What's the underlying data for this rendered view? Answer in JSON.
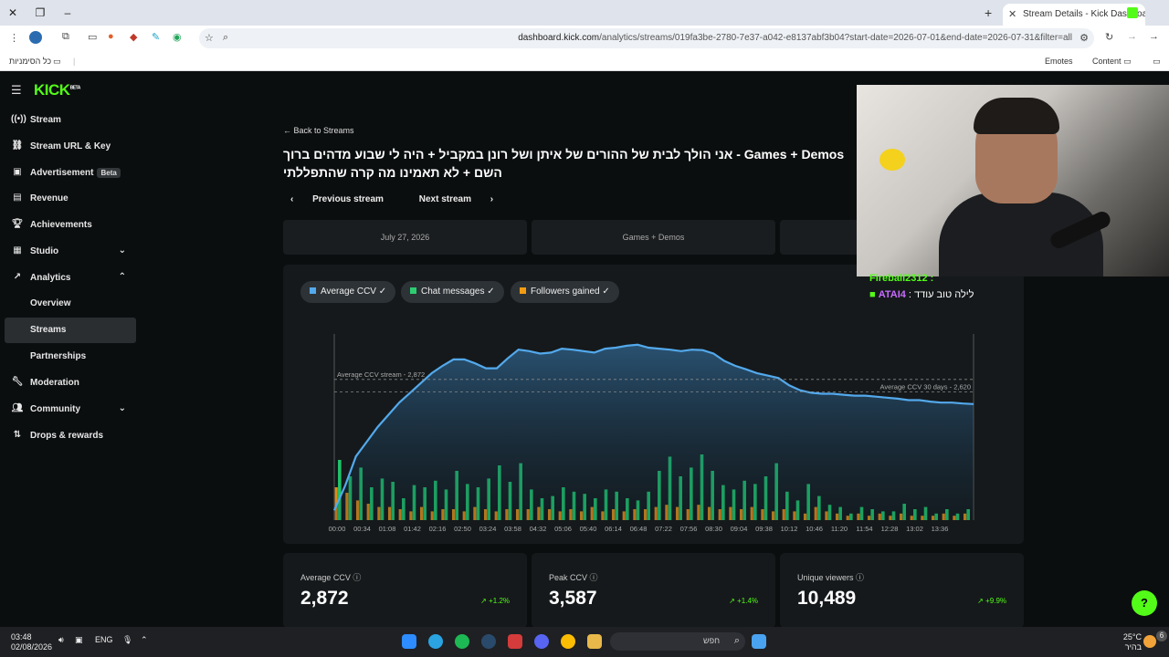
{
  "browser": {
    "tab_title": "Stream Details - Kick Dashboard",
    "url_host": "dashboard.kick.com",
    "url_path": "/analytics/streams/019fa3be-2780-7e37-a042-e8137abf3b04?start-date=2026-07-01&end-date=2026-07-31&filter=all",
    "bookmarks_all": "כל הסימניות",
    "bookmark_emotes": "Emotes",
    "bookmark_content": "Content"
  },
  "sidebar": {
    "logo": "KICK",
    "logo_badge": "BETA",
    "items": [
      {
        "label": "Stream",
        "icon": "stream-icon"
      },
      {
        "label": "Stream URL & Key",
        "icon": "link-icon"
      },
      {
        "label": "Advertisement",
        "icon": "ad-icon",
        "badge": "Beta"
      },
      {
        "label": "Revenue",
        "icon": "revenue-icon"
      },
      {
        "label": "Achievements",
        "icon": "trophy-icon"
      },
      {
        "label": "Studio",
        "icon": "studio-icon"
      },
      {
        "label": "Analytics",
        "icon": "analytics-icon"
      },
      {
        "label": "Overview"
      },
      {
        "label": "Streams"
      },
      {
        "label": "Partnerships"
      },
      {
        "label": "Moderation",
        "icon": "wrench-icon"
      },
      {
        "label": "Community",
        "icon": "community-icon"
      },
      {
        "label": "Drops & rewards",
        "icon": "drops-icon"
      }
    ]
  },
  "main": {
    "back_label": "Back to Streams",
    "title": "Games + Demos - אני הולך לבית של ההורים של איתן ושל רונן במקביל + היה לי שבוע מדהים ברוך השם + לא תאמינו מה קרה שהתפללתי",
    "prev_label": "Previous stream",
    "next_label": "Next stream",
    "info": {
      "date": "July 27, 2026",
      "category": "Games + Demos"
    },
    "filters": [
      {
        "label": "Average CCV",
        "color": "#53a9ec"
      },
      {
        "label": "Chat messages",
        "color": "#2ecc71"
      },
      {
        "label": "Followers gained",
        "color": "#f39c12"
      }
    ],
    "stats": [
      {
        "label": "Average CCV",
        "value": "2,872",
        "change": "+1.2%"
      },
      {
        "label": "Peak CCV",
        "value": "3,587",
        "change": "+1.4%"
      },
      {
        "label": "Unique viewers",
        "value": "10,489",
        "change": "+9.9%"
      }
    ]
  },
  "overlay": {
    "chat_user1": "Fireball2312",
    "chat_user2": "ATAI4",
    "chat_msg2": "לילה טוב עודד"
  },
  "taskbar": {
    "time": "03:48",
    "date": "02/08/2026",
    "lang": "ENG",
    "search_placeholder": "חפש",
    "weather_temp": "25°C",
    "weather_desc": "בהיר",
    "notif_count": "6"
  },
  "chart_data": {
    "type": "line",
    "x_ticks": [
      "00:00",
      "00:34",
      "01:08",
      "01:42",
      "02:16",
      "02:50",
      "03:24",
      "03:58",
      "04:32",
      "05:06",
      "05:40",
      "06:14",
      "06:48",
      "07:22",
      "07:56",
      "08:30",
      "09:04",
      "09:38",
      "10:12",
      "10:46",
      "11:20",
      "11:54",
      "12:28",
      "13:02",
      "13:36"
    ],
    "ylim": [
      0,
      3800
    ],
    "reference_lines": [
      {
        "label": "Average CCV stream - 2,872",
        "value": 2872
      },
      {
        "label": "Average CCV 30 days - 2,620",
        "value": 2620
      }
    ],
    "series": [
      {
        "name": "Average CCV",
        "values": [
          200,
          700,
          1300,
          1600,
          1900,
          2150,
          2400,
          2600,
          2800,
          3000,
          3150,
          3280,
          3280,
          3200,
          3100,
          3100,
          3300,
          3480,
          3450,
          3400,
          3420,
          3500,
          3480,
          3450,
          3420,
          3500,
          3520,
          3560,
          3580,
          3520,
          3500,
          3480,
          3450,
          3480,
          3470,
          3400,
          3250,
          3150,
          3080,
          3000,
          2950,
          2900,
          2750,
          2650,
          2600,
          2580,
          2580,
          2560,
          2540,
          2540,
          2520,
          2500,
          2480,
          2450,
          2450,
          2420,
          2400,
          2400,
          2380,
          2370
        ]
      },
      {
        "name": "Chat messages",
        "values": [
          55,
          40,
          48,
          30,
          38,
          35,
          20,
          32,
          30,
          36,
          28,
          45,
          33,
          30,
          38,
          50,
          35,
          52,
          28,
          20,
          22,
          30,
          26,
          24,
          20,
          28,
          26,
          20,
          18,
          26,
          45,
          58,
          40,
          48,
          60,
          45,
          32,
          28,
          36,
          33,
          40,
          52,
          26,
          18,
          33,
          22,
          14,
          12,
          6,
          12,
          10,
          8,
          8,
          15,
          10,
          12,
          6,
          10,
          6,
          10
        ]
      },
      {
        "name": "Followers gained",
        "values": [
          30,
          25,
          18,
          15,
          12,
          12,
          10,
          8,
          12,
          8,
          10,
          10,
          8,
          12,
          10,
          8,
          10,
          10,
          10,
          12,
          10,
          8,
          10,
          8,
          12,
          8,
          10,
          8,
          10,
          10,
          12,
          14,
          12,
          10,
          14,
          12,
          10,
          12,
          10,
          12,
          10,
          8,
          10,
          8,
          6,
          12,
          8,
          6,
          4,
          6,
          4,
          6,
          4,
          6,
          4,
          4,
          4,
          6,
          4,
          6
        ]
      }
    ]
  }
}
